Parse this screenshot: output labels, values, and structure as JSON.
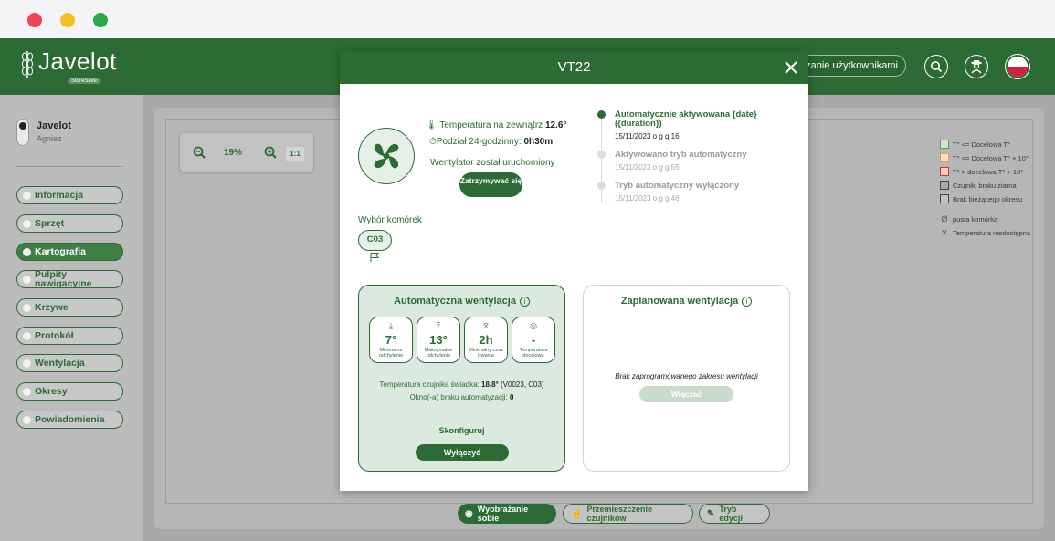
{
  "app": {
    "logo_text": "Javelot",
    "logo_sub": "StoreSave",
    "header": {
      "users_button": "ądzanie użytkownikami"
    }
  },
  "sidebar": {
    "profile": {
      "name": "Javelot",
      "subtitle": "Agniez"
    },
    "items": [
      {
        "label": "Informacja",
        "active": false
      },
      {
        "label": "Sprzęt",
        "active": false
      },
      {
        "label": "Kartografia",
        "active": true
      },
      {
        "label": "Pulpity nawigacyjne",
        "active": false
      },
      {
        "label": "Krzywe",
        "active": false
      },
      {
        "label": "Protokół",
        "active": false
      },
      {
        "label": "Wentylacja",
        "active": false
      },
      {
        "label": "Okresy",
        "active": false
      },
      {
        "label": "Powiadomienia",
        "active": false
      }
    ]
  },
  "map": {
    "zoom_percent": "19%",
    "zoom_reset": "1:1",
    "legend": [
      {
        "label": "T° <= Docelowa T°",
        "color": "#cfe8c9",
        "border": "#5aa050"
      },
      {
        "label": "T° <= Docelowa T° + 10°",
        "color": "#f7e0b8",
        "border": "#d8a050"
      },
      {
        "label": "T° > docelowa T° + 10°",
        "color": "#f4c9c9",
        "border": "#cc3333"
      },
      {
        "label": "Czujniki braku ziarna",
        "color": "#a8a8a8",
        "border": "#444444"
      },
      {
        "label": "Brak bieżącego okresu",
        "color": "#c4c4c4",
        "border": "#444444"
      }
    ],
    "legend_icons": [
      {
        "icon": "Ø",
        "label": "pusta komórka"
      },
      {
        "icon": "✕",
        "label": "Temperatura niedostępna"
      }
    ],
    "bottom_buttons": {
      "view": "Wyobrażanie sobie",
      "move": "Przemieszczenie czujników",
      "edit": "Tryb edycji"
    }
  },
  "modal": {
    "title": "VT22",
    "ext_temp_label": "Temperatura na zewnątrz",
    "ext_temp_value": "12.6°",
    "split_label": "Podział 24-godzinny:",
    "split_value": "0h30m",
    "fan_status": "Wentylator został uruchomiony",
    "stop_button": "Zatrzymywać się",
    "timeline": [
      {
        "title": "Automatycznie aktywowana {date} ({duration})",
        "date": "15/11/2023 o g g 16",
        "active": true
      },
      {
        "title": "Aktywowano tryb automatyczny",
        "date": "15/11/2023 o g g 55",
        "active": false
      },
      {
        "title": "Tryb automatyczny wyłączony",
        "date": "15/11/2023 o g g 46",
        "active": false
      }
    ],
    "cells_label": "Wybór komórek",
    "cell_chip": "C03",
    "auto": {
      "title": "Automatyczna wentylacja",
      "info": "i",
      "stats": [
        {
          "icon": "⤓",
          "value": "7°",
          "label": "Minimalne odchylenie"
        },
        {
          "icon": "⤒",
          "value": "13°",
          "label": "Maksymalne odchylenie"
        },
        {
          "icon": "⧖",
          "value": "2h",
          "label": "Minimalny czas trwania"
        },
        {
          "icon": "◎",
          "value": "-",
          "label": "Temperatura docelowa"
        }
      ],
      "sensor_label": "Temperatura czujnika świadka:",
      "sensor_value": "18.8°",
      "sensor_ref": "(V0023, C03)",
      "window_label": "Okno(-a) braku automatyzacji:",
      "window_value": "0",
      "configure": "Skonfiguruj",
      "off_button": "Wyłączyć"
    },
    "scheduled": {
      "title": "Zaplanowana wentylacja",
      "info": "i",
      "empty_text": "Brak zaprogramowanego zakresu wentylacji",
      "on_button": "Włączać"
    }
  },
  "colors": {
    "brand": "#2c6b34",
    "brand_light": "#dce9de",
    "mac_red": "#ed4655",
    "mac_yellow": "#f6c01e",
    "mac_green": "#2aa84a"
  }
}
